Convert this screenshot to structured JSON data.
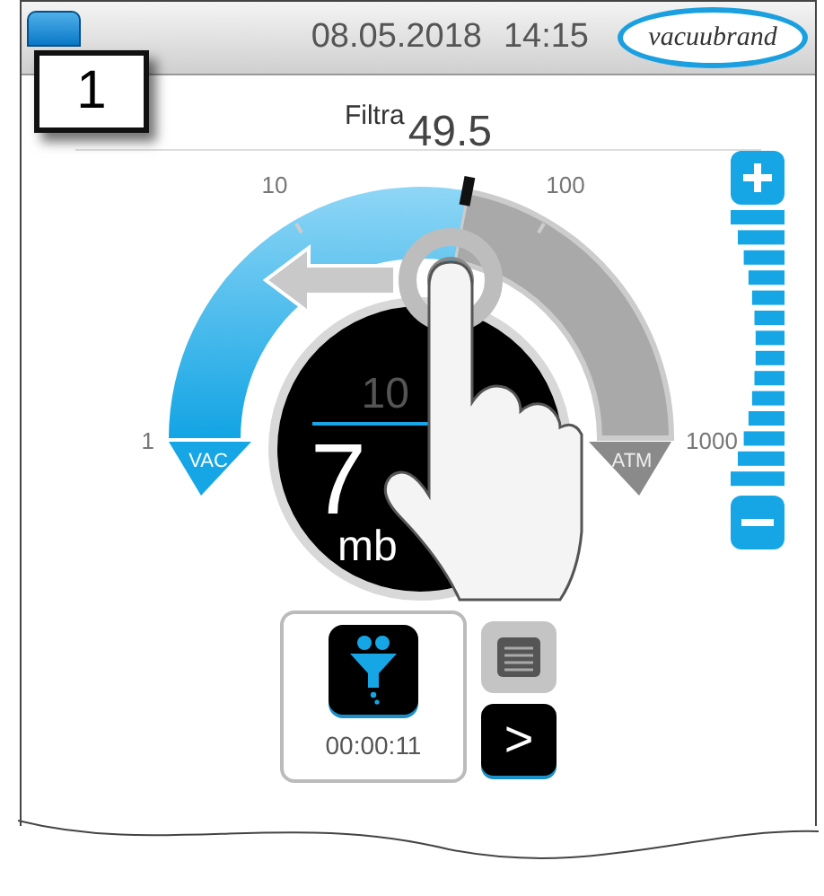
{
  "callout": "1",
  "header": {
    "date": "08.05.2018",
    "time": "14:15",
    "logo": "vacuubrand"
  },
  "mode_label": "Filtra",
  "setpoint": "49.5",
  "gauge": {
    "ticks": [
      {
        "label": "1"
      },
      {
        "label": "10"
      },
      {
        "label": "100"
      },
      {
        "label": "1000"
      }
    ],
    "vac_label": "VAC",
    "atm_label": "ATM",
    "inner_value": "10",
    "value": "7",
    "unit": "mb"
  },
  "program": {
    "timer": "00:00:11"
  },
  "next_button": ">"
}
